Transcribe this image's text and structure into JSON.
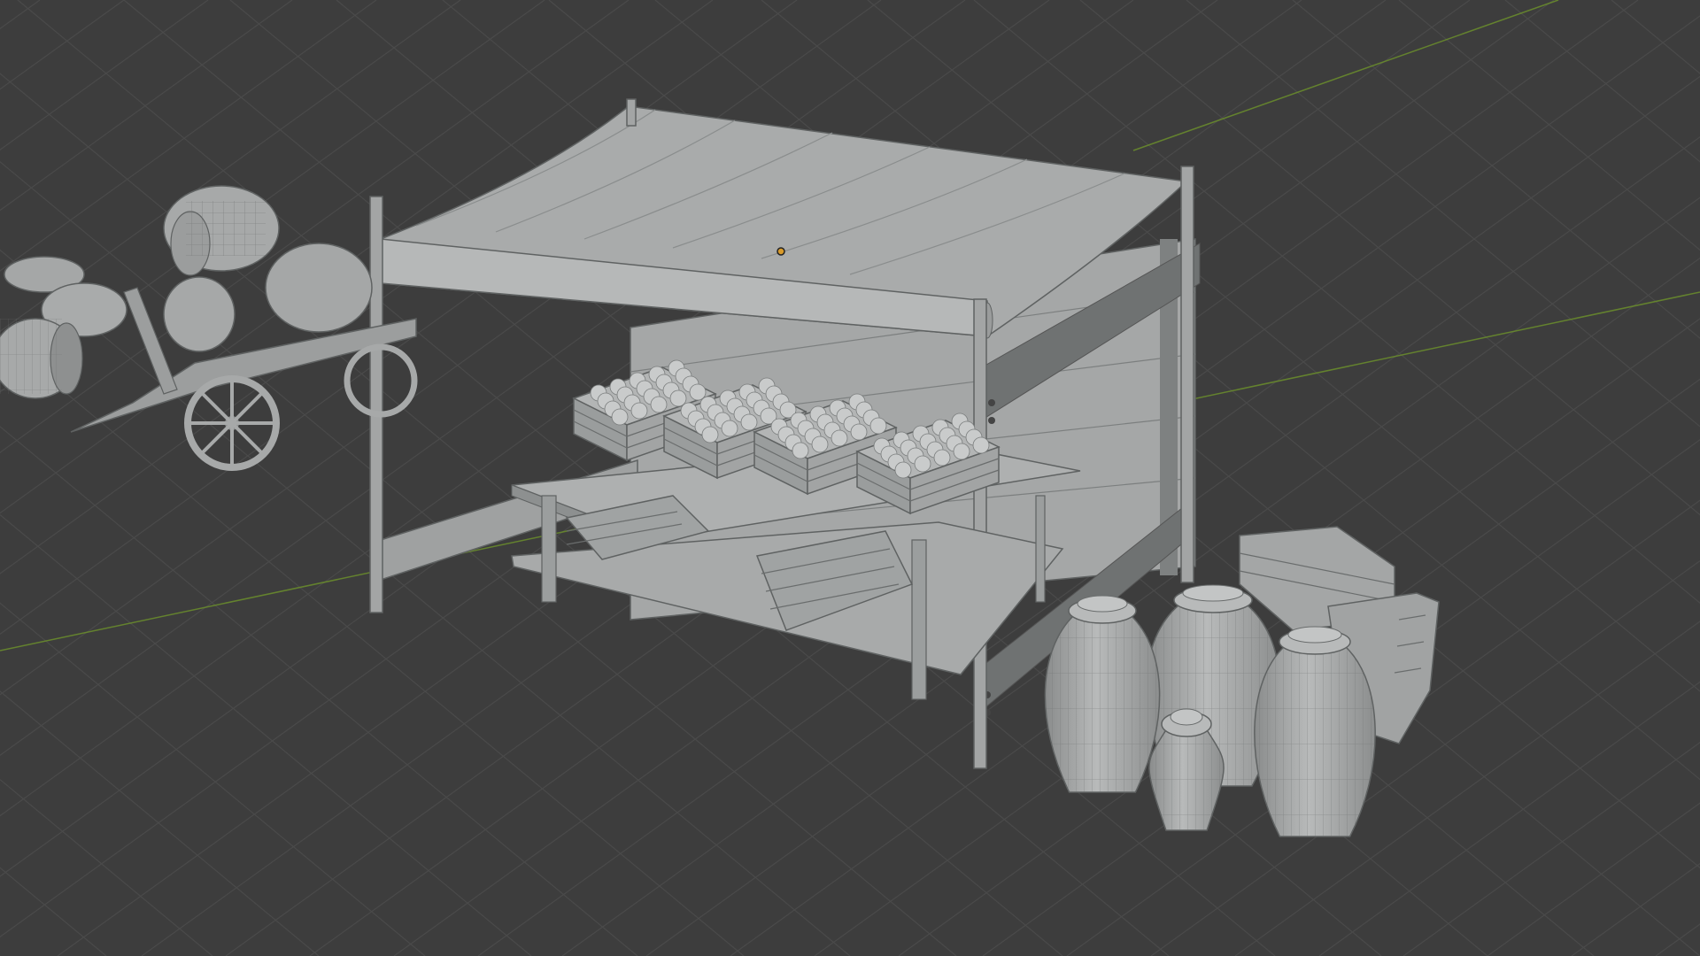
{
  "viewport": {
    "view": "3D Viewport",
    "shading": "solid",
    "background": "#3d3d3d",
    "grid_color": "#4a4a4a",
    "axis_x_color": "#8e3a3a",
    "axis_y_color": "#6b8f2c",
    "model_color": "#a9abab",
    "wire_color": "#5f6262"
  },
  "scene": {
    "objects": [
      "market-stall",
      "stall-awning",
      "fruit-crate",
      "empty-crate",
      "stall-table",
      "clay-jar",
      "barrel",
      "hand-cart",
      "origin-marker"
    ]
  }
}
